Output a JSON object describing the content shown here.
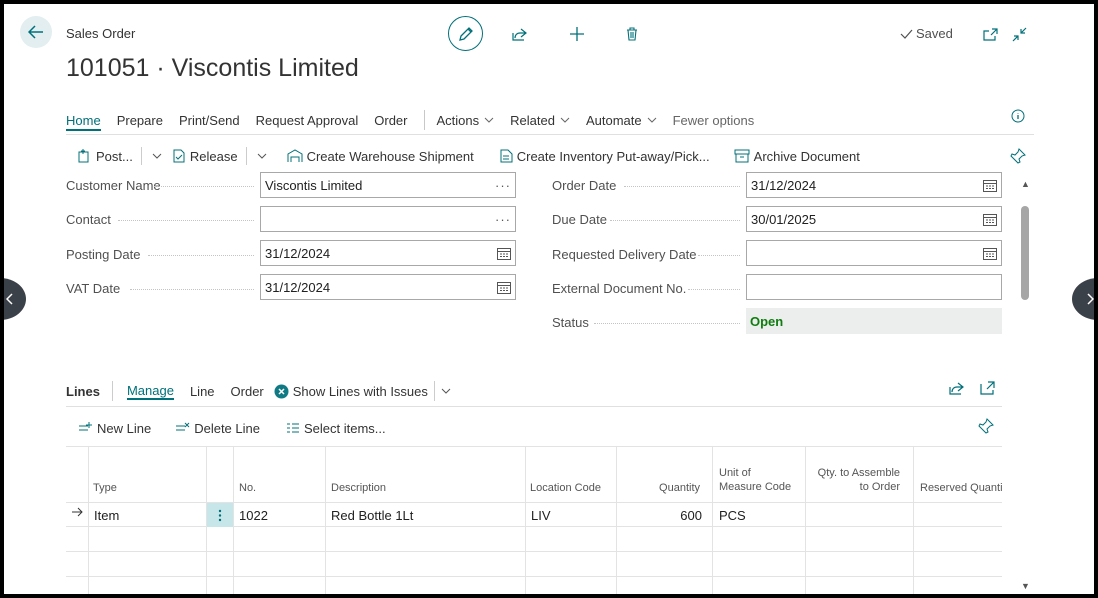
{
  "header": {
    "page_kind": "Sales Order",
    "title": "101051 · Viscontis Limited",
    "saved_label": "Saved"
  },
  "menu": {
    "items": [
      "Home",
      "Prepare",
      "Print/Send",
      "Request Approval",
      "Order"
    ],
    "dropdowns": [
      "Actions",
      "Related",
      "Automate"
    ],
    "fewer": "Fewer options"
  },
  "actions": {
    "post": "Post...",
    "release": "Release",
    "create_wh": "Create Warehouse Shipment",
    "create_inv": "Create Inventory Put-away/Pick...",
    "archive": "Archive Document"
  },
  "form": {
    "left": [
      {
        "label": "Customer Name",
        "value": "Viscontis Limited",
        "kind": "lookup"
      },
      {
        "label": "Contact",
        "value": "",
        "kind": "lookup"
      },
      {
        "label": "Posting Date",
        "value": "31/12/2024",
        "kind": "date"
      },
      {
        "label": "VAT Date",
        "value": "31/12/2024",
        "kind": "date"
      }
    ],
    "right": [
      {
        "label": "Order Date",
        "value": "31/12/2024",
        "kind": "date"
      },
      {
        "label": "Due Date",
        "value": "30/01/2025",
        "kind": "date"
      },
      {
        "label": "Requested Delivery Date",
        "value": "",
        "kind": "date"
      },
      {
        "label": "External Document No.",
        "value": "",
        "kind": "text"
      },
      {
        "label": "Status",
        "value": "Open",
        "kind": "status"
      }
    ]
  },
  "lines": {
    "title": "Lines",
    "tabs": [
      "Manage",
      "Line",
      "Order"
    ],
    "show_issues": "Show Lines with Issues",
    "new_line": "New Line",
    "delete_line": "Delete Line",
    "select_items": "Select items...",
    "columns": {
      "type": "Type",
      "no": "No.",
      "description": "Description",
      "location": "Location Code",
      "quantity": "Quantity",
      "uom_1": "Unit of",
      "uom_2": "Measure Code",
      "qty_assemble_1": "Qty. to Assemble",
      "qty_assemble_2": "to Order",
      "reserved": "Reserved Quantity"
    },
    "rows": [
      {
        "type": "Item",
        "no": "1022",
        "description": "Red Bottle 1Lt",
        "location": "LIV",
        "quantity": "600",
        "uom": "PCS"
      }
    ]
  },
  "colors": {
    "accent": "#00707a",
    "status_open": "#107c10"
  }
}
